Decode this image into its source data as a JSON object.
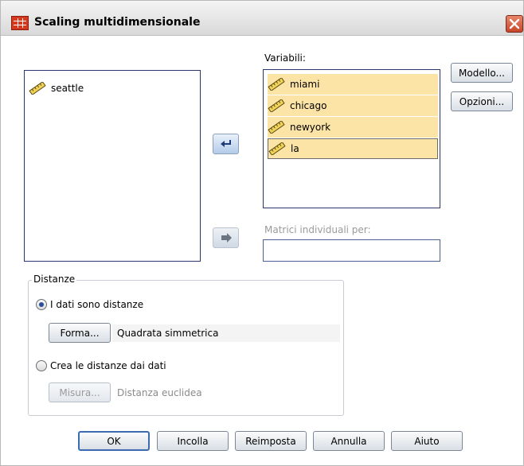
{
  "window": {
    "title": "Scaling multidimensionale",
    "close_icon": "close-icon"
  },
  "source_list": {
    "items": [
      {
        "label": "seattle",
        "icon": "ruler-scale-icon"
      }
    ]
  },
  "variables": {
    "label": "Variabili:",
    "items": [
      {
        "label": "miami",
        "icon": "ruler-scale-icon"
      },
      {
        "label": "chicago",
        "icon": "ruler-scale-icon"
      },
      {
        "label": "newyork",
        "icon": "ruler-scale-icon"
      },
      {
        "label": "la",
        "icon": "ruler-scale-icon"
      }
    ]
  },
  "individual_matrices": {
    "label": "Matrici individuali per:",
    "value": ""
  },
  "side_buttons": {
    "model": "Modello...",
    "options": "Opzioni..."
  },
  "distances": {
    "legend": "Distanze",
    "option_data_are_distances": "I dati sono distanze",
    "shape_button": "Forma...",
    "shape_value": "Quadrata simmetrica",
    "option_create_distances": "Crea le distanze dai dati",
    "measure_button": "Misura...",
    "measure_value": "Distanza euclidea",
    "selected_option": "I dati sono distanze"
  },
  "footer_buttons": {
    "ok": "OK",
    "paste": "Incolla",
    "reset": "Reimposta",
    "cancel": "Annulla",
    "help": "Aiuto"
  },
  "colors": {
    "selection": "#fbe4a6",
    "listbox_border": "#29356b",
    "close_button": "#c8462a",
    "default_button_border": "#3c6bb0"
  }
}
